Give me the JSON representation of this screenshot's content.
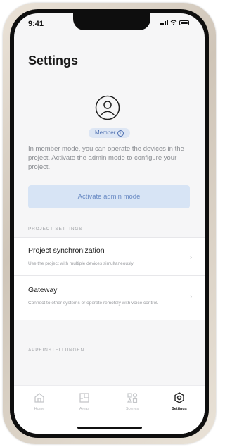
{
  "status_bar": {
    "time": "9:41"
  },
  "header": {
    "title": "Settings"
  },
  "profile": {
    "role_badge": "Member",
    "description": "In member mode, you can operate the devices in the project. Activate the admin mode to configure your project.",
    "admin_button": "Activate admin mode"
  },
  "project_settings": {
    "section_label": "PROJECT SETTINGS",
    "items": [
      {
        "title": "Project synchronization",
        "subtitle": "Use the project with multiple devices simultaneously"
      },
      {
        "title": "Gateway",
        "subtitle": "Connect to other systems or operate remotely with voice control."
      }
    ]
  },
  "app_settings": {
    "section_label": "APPEINSTELLUNGEN"
  },
  "tabbar": {
    "tabs": [
      {
        "label": "Home",
        "icon": "home-icon"
      },
      {
        "label": "Areas",
        "icon": "areas-icon"
      },
      {
        "label": "Scenes",
        "icon": "scenes-icon"
      },
      {
        "label": "Settings",
        "icon": "settings-icon",
        "active": true
      }
    ]
  },
  "colors": {
    "accent": "#4d6fb0",
    "button_bg": "#d7e4f5",
    "badge_bg": "#dde6f4",
    "background": "#f6f6f7"
  }
}
